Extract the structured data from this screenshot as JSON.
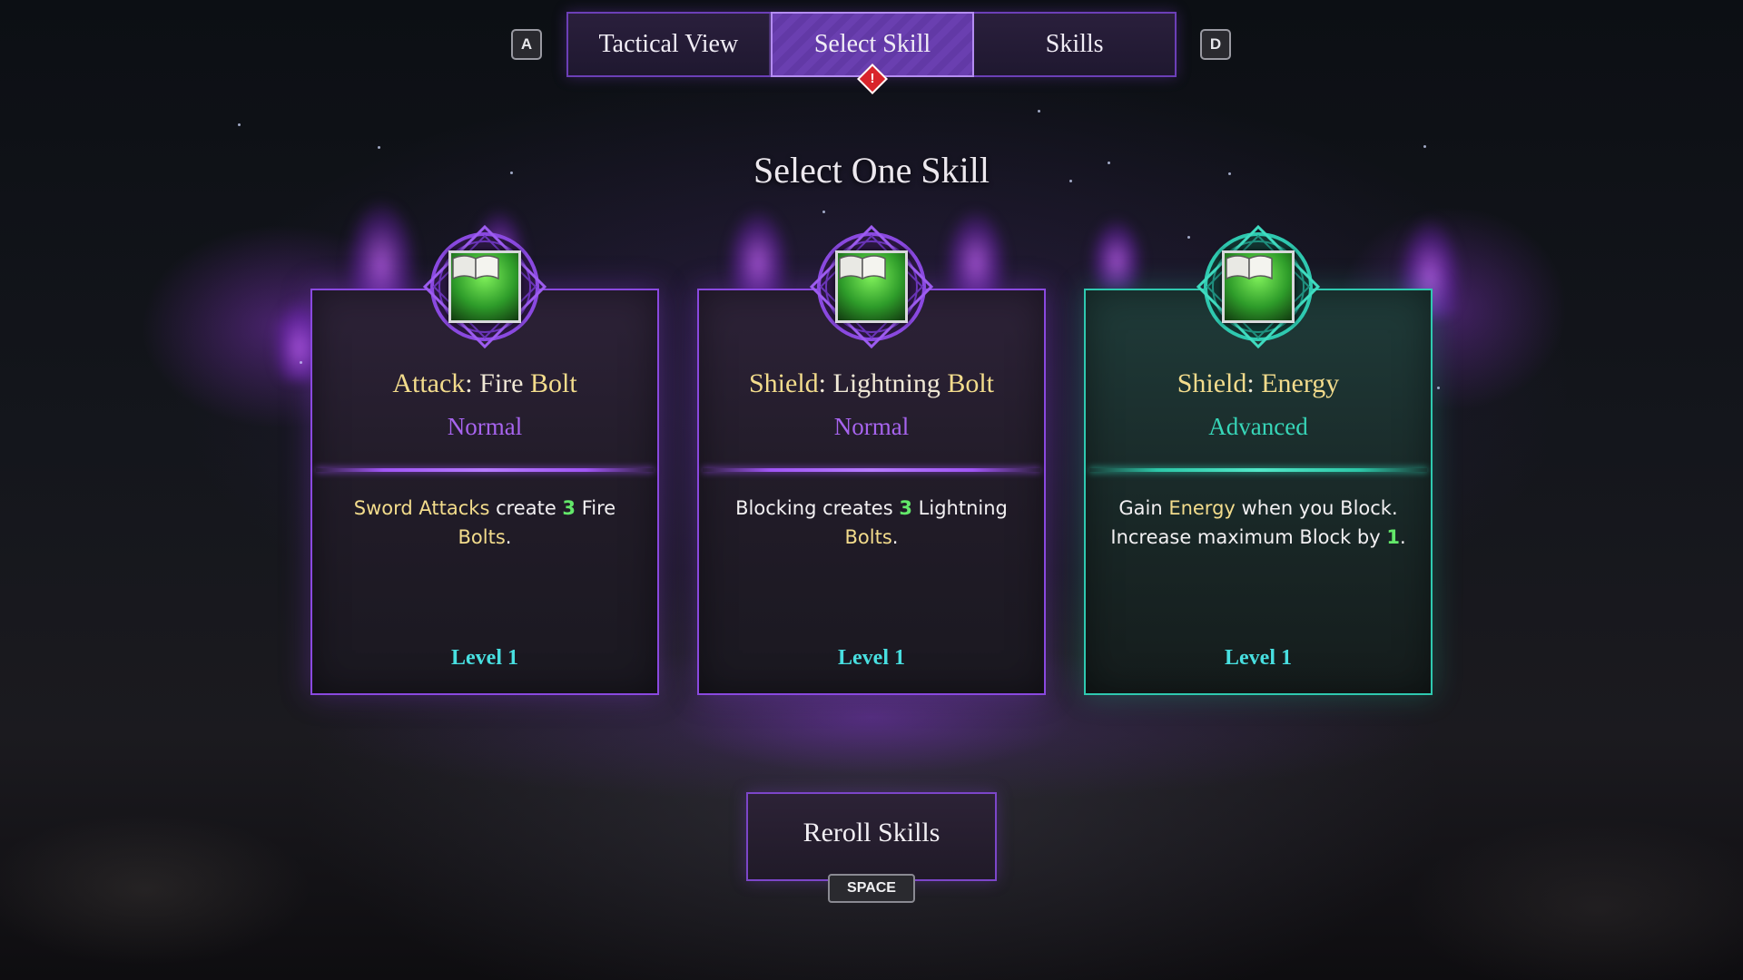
{
  "nav": {
    "prev_key": "A",
    "next_key": "D",
    "tabs": [
      {
        "label": "Tactical View",
        "active": false
      },
      {
        "label": "Select Skill",
        "active": true,
        "alert": "!"
      },
      {
        "label": "Skills",
        "active": false
      }
    ]
  },
  "heading": "Select One Skill",
  "cards": [
    {
      "title_keyword": "Attack",
      "title_sep": ": Fire ",
      "title_tail": "Bolt",
      "rarity": "Normal",
      "desc_a": "Sword Attacks",
      "desc_b": " create ",
      "desc_num": "3",
      "desc_c": " Fire",
      "desc_d": "Bolts",
      "desc_e": ".",
      "level": "Level 1",
      "icon": "spellbook-icon"
    },
    {
      "title_keyword": "Shield",
      "title_sep": ": Lightning ",
      "title_tail": "Bolt",
      "rarity": "Normal",
      "desc_a": "Blocking creates ",
      "desc_num": "3",
      "desc_c": " Lightning",
      "desc_d": "Bolts",
      "desc_e": ".",
      "level": "Level 1",
      "icon": "spellbook-icon"
    },
    {
      "title_keyword": "Shield",
      "title_sep": ": ",
      "title_tail": "Energy",
      "rarity": "Advanced",
      "desc_a": "Gain ",
      "desc_kw": "Energy",
      "desc_b": " when you Block.",
      "desc_c": "Increase maximum Block by ",
      "desc_num": "1",
      "desc_e": ".",
      "level": "Level 1",
      "icon": "spellbook-icon"
    }
  ],
  "reroll": {
    "label": "Reroll Skills",
    "key": "SPACE"
  },
  "colors": {
    "normal_accent": "#8a49e0",
    "advanced_accent": "#2fc9b0",
    "keyword": "#f3dc8c",
    "number": "#63e86a",
    "level": "#48dfe0"
  }
}
